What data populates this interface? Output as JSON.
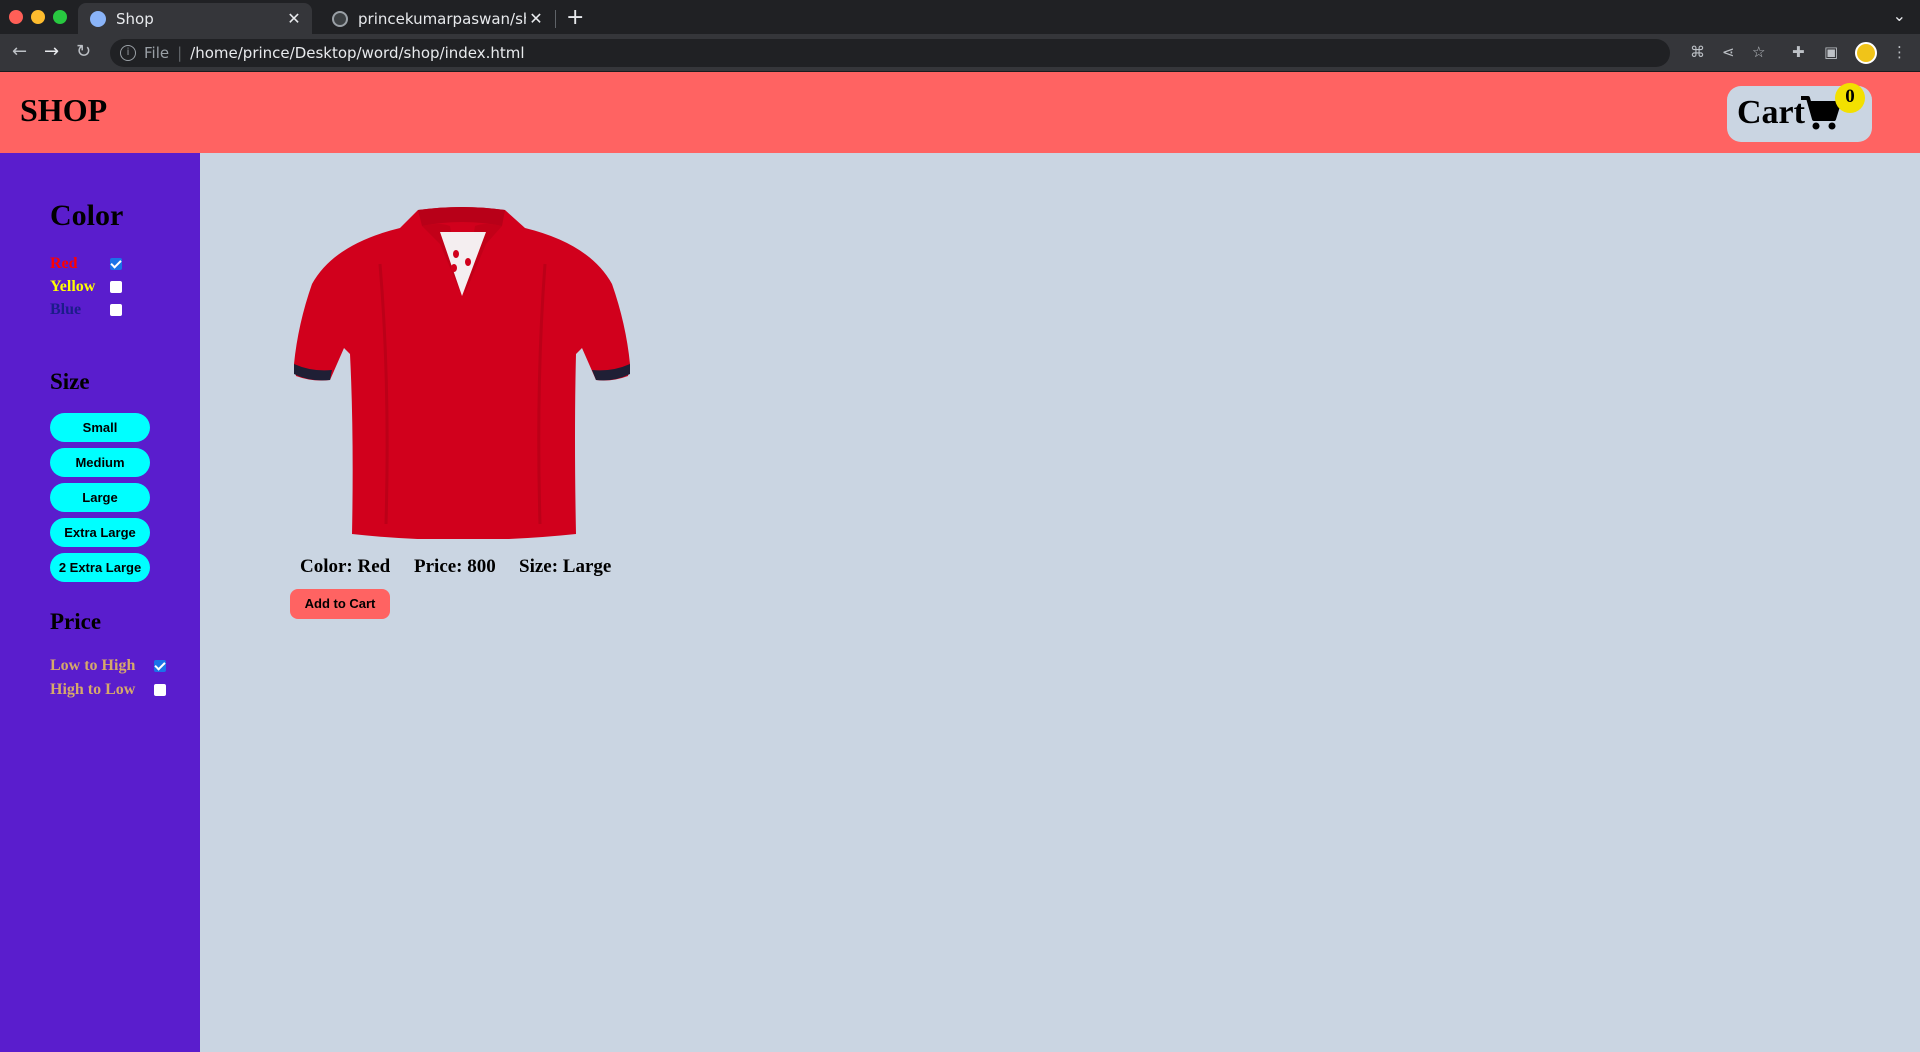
{
  "browser": {
    "tabs": [
      {
        "title": "Shop",
        "active": true
      },
      {
        "title": "princekumarpaswan/shop",
        "active": false
      }
    ],
    "address": {
      "scheme": "File",
      "url": "/home/prince/Desktop/word/shop/index.html"
    }
  },
  "header": {
    "logo": "SHOP",
    "cart_label": "Cart",
    "cart_count": "0"
  },
  "sidebar": {
    "color_heading": "Color",
    "colors": [
      {
        "label": "Red",
        "checked": true,
        "text_color": "#ff0000"
      },
      {
        "label": "Yellow",
        "checked": false,
        "text_color": "#ffff00"
      },
      {
        "label": "Blue",
        "checked": false,
        "text_color": "#1c1c8a"
      }
    ],
    "size_heading": "Size",
    "sizes": [
      "Small",
      "Medium",
      "Large",
      "Extra Large",
      "2 Extra Large"
    ],
    "price_heading": "Price",
    "price_sorts": [
      {
        "label": "Low to High",
        "checked": true
      },
      {
        "label": "High to Low",
        "checked": false
      }
    ],
    "price_text_color": "#d6a96a"
  },
  "product": {
    "image": "red-polo-shirt",
    "color": "Color: Red",
    "price": "Price: 800",
    "size": "Size: Large",
    "add_button": "Add to Cart"
  },
  "colors": {
    "header_bg": "#ff6362",
    "sidebar_bg": "#5a1dcd",
    "page_bg": "#cad5e2",
    "size_button_bg": "#00ffff",
    "badge_bg": "#f3e000"
  }
}
